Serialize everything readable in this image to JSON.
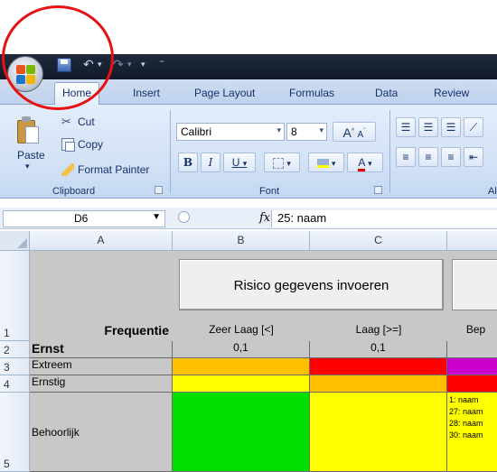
{
  "quick_access": {
    "separator": "⁼"
  },
  "ribbon_tabs": [
    "Home",
    "Insert",
    "Page Layout",
    "Formulas",
    "Data",
    "Review"
  ],
  "clipboard": {
    "paste_label": "Paste",
    "cut_label": "Cut",
    "copy_label": "Copy",
    "format_painter_label": "Format Painter",
    "group_label": "Clipboard"
  },
  "font": {
    "family": "Calibri",
    "size": "8",
    "group_label": "Font",
    "bold": "B",
    "italic": "I",
    "underline": "U",
    "grow": "A",
    "shrink": "A",
    "font_color": "A"
  },
  "alignment": {
    "group_label_partial": "Al"
  },
  "formula_bar": {
    "cell_ref": "D6",
    "fx": "fx",
    "content": "25: naam"
  },
  "columns": [
    "A",
    "B",
    "C"
  ],
  "rows": [
    "1",
    "2",
    "3",
    "4",
    "5"
  ],
  "sheet": {
    "button_label": "Risico gegevens invoeren",
    "row1": {
      "A": "Frequentie",
      "B": "Zeer Laag [<]",
      "C": "Laag [>=]",
      "D": "Bep"
    },
    "row2": {
      "A": "Ernst",
      "B": "0,1",
      "C": "0,1"
    },
    "row3": {
      "A": "Extreem"
    },
    "row4": {
      "A": "Ernstig"
    },
    "row5": {
      "A": "Behoorlijk",
      "D_lines": [
        "1: naam",
        "27: naam",
        "28: naam",
        "30: naam"
      ]
    }
  },
  "colors": {
    "orange": "#ffc000",
    "red": "#ff0000",
    "purple": "#cc00cc",
    "yellow": "#ffff00",
    "green": "#00e000",
    "annotation": "#e81010"
  }
}
